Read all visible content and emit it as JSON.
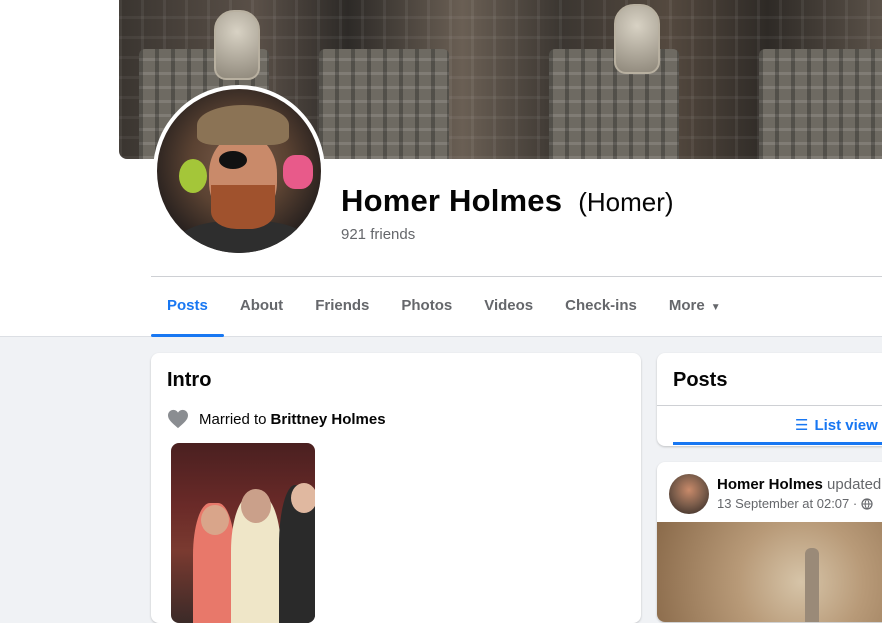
{
  "profile": {
    "name": "Homer Holmes",
    "nickname": "(Homer)",
    "friends": "921 friends"
  },
  "tabs": [
    {
      "label": "Posts",
      "active": true
    },
    {
      "label": "About"
    },
    {
      "label": "Friends"
    },
    {
      "label": "Photos"
    },
    {
      "label": "Videos"
    },
    {
      "label": "Check-ins"
    },
    {
      "label": "More"
    }
  ],
  "intro": {
    "title": "Intro",
    "married_prefix": "Married to",
    "spouse": "Brittney Holmes"
  },
  "posts_panel": {
    "title": "Posts",
    "list_view": "List view"
  },
  "feed": {
    "author": "Homer Holmes",
    "action": "updated",
    "timestamp": "13 September at 02:07 ·"
  },
  "colors": {
    "accent": "#1877f2",
    "muted_text": "#65676b",
    "background": "#f0f2f5"
  },
  "icons": {
    "heart": "heart-icon",
    "list": "list-icon",
    "globe": "globe-icon",
    "more_caret": "caret-down-icon"
  }
}
